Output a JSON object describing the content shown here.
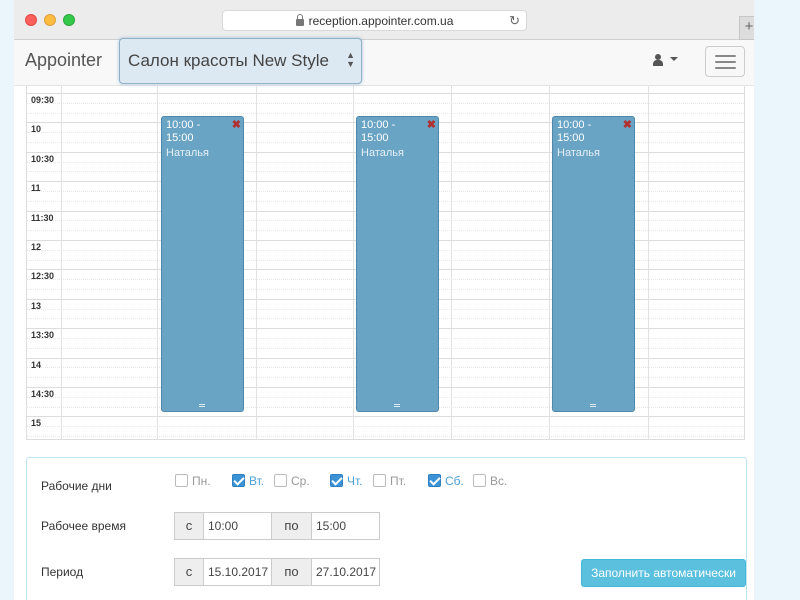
{
  "browser": {
    "url": "reception.appointer.com.ua",
    "new_tab": "+"
  },
  "navbar": {
    "brand": "Appointer",
    "salon": "Салон красоты New Style"
  },
  "calendar": {
    "time_labels": [
      "09:30",
      "10",
      "10:30",
      "11",
      "11:30",
      "12",
      "12:30",
      "13",
      "13:30",
      "14",
      "14:30",
      "15"
    ],
    "events": [
      {
        "time": "10:00 - 15:00",
        "name": "Наталья"
      },
      {
        "time": "10:00 - 15:00",
        "name": "Наталья"
      },
      {
        "time": "10:00 - 15:00",
        "name": "Наталья"
      }
    ]
  },
  "settings": {
    "work_days_label": "Рабочие дни",
    "days": [
      {
        "label": "Пн.",
        "checked": false
      },
      {
        "label": "Вт.",
        "checked": true
      },
      {
        "label": "Ср.",
        "checked": false
      },
      {
        "label": "Чт.",
        "checked": true
      },
      {
        "label": "Пт.",
        "checked": false
      },
      {
        "label": "Сб.",
        "checked": true
      },
      {
        "label": "Вс.",
        "checked": false
      }
    ],
    "work_time_label": "Рабочее время",
    "work_time": {
      "from_label": "с",
      "from": "10:00",
      "to_label": "по",
      "to": "15:00"
    },
    "period_label": "Период",
    "period": {
      "from_label": "с",
      "from": "15.10.2017",
      "to_label": "по",
      "to": "27.10.2017"
    },
    "autofill_label": "Заполнить автоматически"
  },
  "colors": {
    "event_fill": "#6aa4c5",
    "accent": "#5bc0de",
    "checkbox_on": "#3b93d6"
  }
}
